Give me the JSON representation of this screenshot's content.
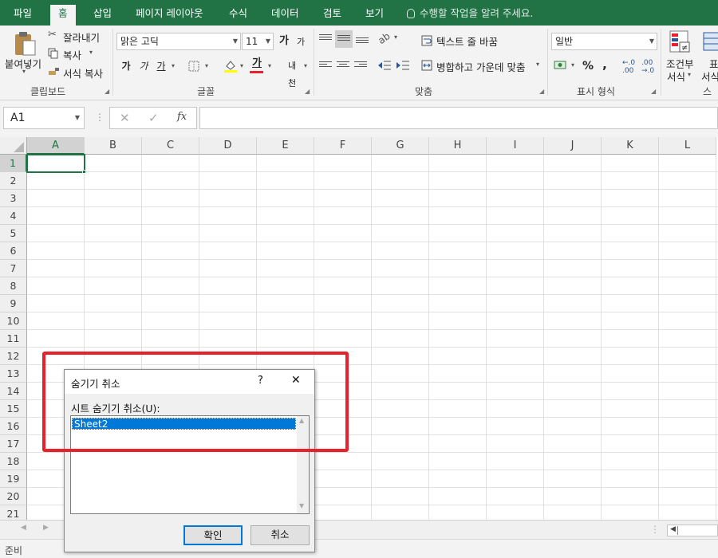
{
  "tabs": [
    "파일",
    "홈",
    "삽입",
    "페이지 레이아웃",
    "수식",
    "데이터",
    "검토",
    "보기"
  ],
  "tell_me": "수행할 작업을 알려 주세요.",
  "clipboard": {
    "paste": "붙여넣기",
    "cut": "잘라내기",
    "copy": "복사",
    "format_painter": "서식 복사",
    "label": "클립보드"
  },
  "font": {
    "name": "맑은 고딕",
    "size": "11",
    "bold": "가",
    "italic": "가",
    "underline": "가",
    "color_letter": "가",
    "phonetic": "내천",
    "grow": "가",
    "shrink": "가",
    "label": "글꼴"
  },
  "alignment": {
    "wrap_text": "텍스트 줄 바꿈",
    "merge_center": "병합하고 가운데 맞춤",
    "label": "맞춤"
  },
  "number": {
    "format": "일반",
    "percent": "%",
    "comma": ",",
    "label": "표시 형식"
  },
  "styles": {
    "conditional_line1": "조건부",
    "conditional_line2": "서식",
    "table_line1": "표",
    "table_line2": "서식",
    "label_partial": "스"
  },
  "formula_bar": {
    "name_box": "A1",
    "fx": "fx",
    "value": ""
  },
  "columns": [
    "A",
    "B",
    "C",
    "D",
    "E",
    "F",
    "G",
    "H",
    "I",
    "J",
    "K",
    "L"
  ],
  "rows": [
    "1",
    "2",
    "3",
    "4",
    "5",
    "6",
    "7",
    "8",
    "9",
    "10",
    "11",
    "12",
    "13",
    "14",
    "15",
    "16",
    "17",
    "18",
    "19",
    "20",
    "21"
  ],
  "status": {
    "ready": "준비"
  },
  "dialog": {
    "title": "숨기기 취소",
    "help": "?",
    "close": "✕",
    "list_label": "시트 숨기기 취소(U):",
    "items": [
      "Sheet2"
    ],
    "ok": "확인",
    "cancel": "취소"
  },
  "colors": {
    "accent": "#217346",
    "highlight": "#e8212a",
    "selection": "#0078d7"
  }
}
